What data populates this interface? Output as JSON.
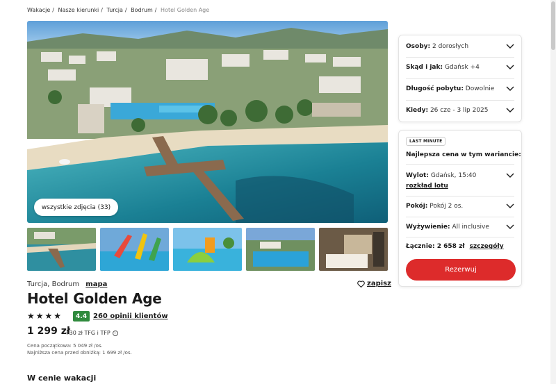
{
  "breadcrumb": [
    "Wakacje",
    "Nasze kierunki",
    "Turcja",
    "Bodrum",
    "Hotel Golden Age"
  ],
  "gallery": {
    "all_photos_label": "wszystkie zdjęcia (33)"
  },
  "hotel": {
    "location": "Turcja, Bodrum",
    "map_link": "mapa",
    "save_label": "zapisz",
    "name": "Hotel Golden Age",
    "stars": 4,
    "rating": "4.4",
    "reviews": "260 opinii klientów",
    "price": "1 299 zł",
    "price_extra": "+30 zł TFG i TFP",
    "initial_price": "Cena początkowa: 5 049 zł /os.",
    "lowest_price": "Najniższa cena przed obniżką: 1 699 zł /os."
  },
  "section": {
    "included_title": "W cenie wakacji"
  },
  "search_panel": {
    "guests": {
      "label": "Osoby:",
      "value": "2 dorosłych"
    },
    "origin": {
      "label": "Skąd i jak:",
      "value": "Gdańsk +4"
    },
    "duration": {
      "label": "Długość pobytu:",
      "value": "Dowolnie"
    },
    "dates": {
      "label": "Kiedy:",
      "value": "26 cze - 3 lip 2025"
    }
  },
  "offer_panel": {
    "badge": "LAST MINUTE",
    "best_price": "Najlepsza cena w tym wariancie:",
    "flight": {
      "label": "Wylot:",
      "value": "Gdańsk, 15:40"
    },
    "flight_link": "rozkład lotu",
    "room": {
      "label": "Pokój:",
      "value": "Pokój 2 os."
    },
    "board": {
      "label": "Wyżywienie:",
      "value": "All inclusive"
    },
    "total": {
      "label": "Łącznie: 2 658 zł",
      "link": "szczegóły"
    },
    "book_label": "Rezerwuj"
  },
  "colors": {
    "accent": "#dd2b2b",
    "rating": "#2f8a3d"
  },
  "icons": [
    "heart-icon",
    "star-icon",
    "chevron-down-icon",
    "info-icon"
  ]
}
